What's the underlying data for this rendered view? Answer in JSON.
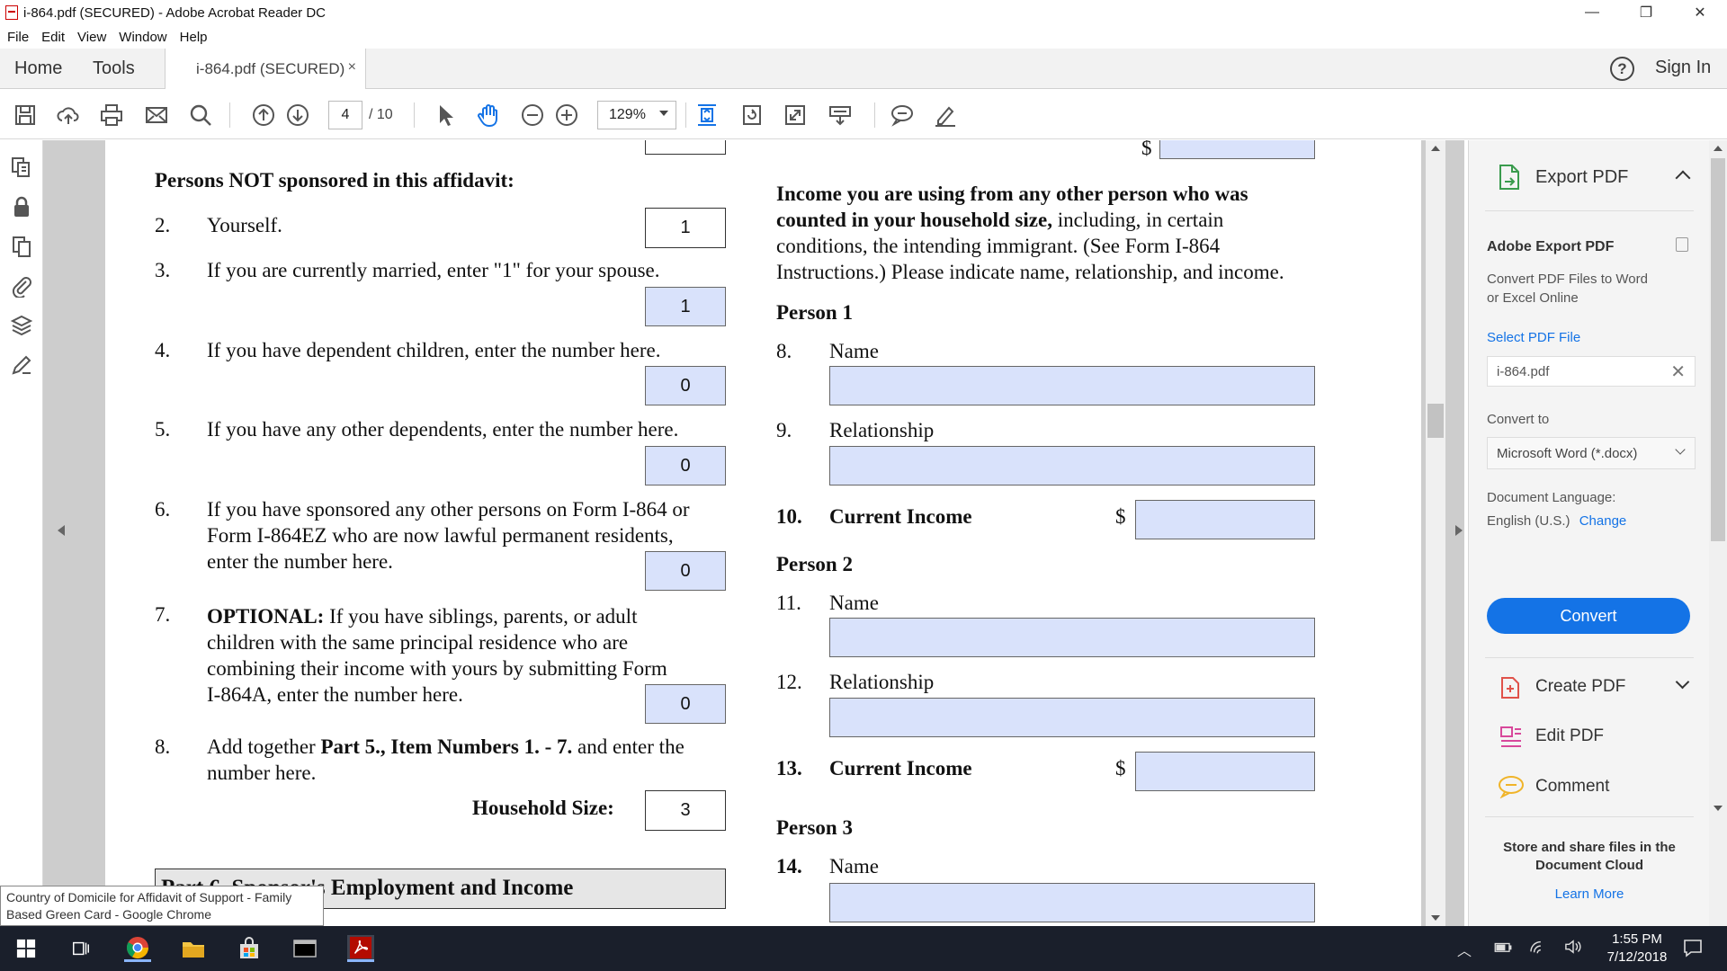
{
  "window": {
    "title": "i-864.pdf (SECURED) - Adobe Acrobat Reader DC",
    "minimize_glyph": "—",
    "maximize_glyph": "❐",
    "close_glyph": "✕"
  },
  "menu": [
    "File",
    "Edit",
    "View",
    "Window",
    "Help"
  ],
  "tabs": {
    "home": "Home",
    "tools": "Tools",
    "doc": "i-864.pdf (SECURED)",
    "close_glyph": "×",
    "help_glyph": "?",
    "sign_in": "Sign In"
  },
  "toolbar": {
    "page_current": "4",
    "page_total": "/ 10",
    "zoom": "129%"
  },
  "document": {
    "top_dollar": "$",
    "left": {
      "heading": "Persons NOT sponsored in this affidavit:",
      "items": [
        {
          "num": "2.",
          "text": "Yourself.",
          "value": "1"
        },
        {
          "num": "3.",
          "text": "If you are currently married, enter \"1\" for your spouse.",
          "value": "1"
        },
        {
          "num": "4.",
          "text": "If you have dependent children, enter the number here.",
          "value": "0"
        },
        {
          "num": "5.",
          "text": "If you have any other dependents, enter the number here.",
          "value": "0"
        },
        {
          "num": "6.",
          "lines": [
            "If you have sponsored any other persons on Form I-864 or",
            "Form I-864EZ who are now lawful permanent residents,",
            "enter the number here."
          ],
          "value": "0"
        },
        {
          "num": "7.",
          "optional_label": "OPTIONAL:",
          "lines": [
            "If you have siblings, parents, or adult",
            "children with the same principal residence who are",
            "combining their income with yours by submitting Form",
            "I-864A, enter the number here."
          ],
          "value": "0"
        },
        {
          "num": "8.",
          "line1_pre": "Add together ",
          "line1_bold": "Part 5., Item Numbers 1. - 7.",
          "line1_post": " and enter the",
          "line2": "number here."
        }
      ],
      "household_label": "Household Size:",
      "household_value": "3",
      "part6_title": "Part 6.  Sponsor's Employment and Income"
    },
    "right": {
      "intro_bold1": "Income you are using from any other person who was",
      "intro_bold2": "counted in your household size,",
      "intro_rest2": " including, in certain",
      "intro_line3": "conditions, the intending immigrant.  (See Form I-864",
      "intro_line4": "Instructions.)  Please indicate name, relationship, and income.",
      "person1": "Person 1",
      "person2": "Person 2",
      "person3": "Person 3",
      "f8": {
        "num": "8.",
        "label": "Name"
      },
      "f9": {
        "num": "9.",
        "label": "Relationship"
      },
      "f10": {
        "num": "10.",
        "label": "Current Income"
      },
      "f11": {
        "num": "11.",
        "label": "Name"
      },
      "f12": {
        "num": "12.",
        "label": "Relationship"
      },
      "f13": {
        "num": "13.",
        "label": "Current Income"
      },
      "f14": {
        "num": "14.",
        "label": "Name"
      },
      "dollar": "$"
    }
  },
  "right_panel": {
    "export_pdf": "Export PDF",
    "adobe_export_pdf": "Adobe Export PDF",
    "desc_line1": "Convert PDF Files to Word",
    "desc_line2": "or Excel Online",
    "select_file": "Select PDF File",
    "file_name": "i-864.pdf",
    "convert_to_label": "Convert to",
    "convert_to_value": "Microsoft Word (*.docx)",
    "doc_lang_label": "Document Language:",
    "doc_lang_value": "English (U.S.)",
    "change": "Change",
    "convert_btn": "Convert",
    "create_pdf": "Create PDF",
    "edit_pdf": "Edit PDF",
    "comment": "Comment",
    "cloud_line1": "Store and share files in the",
    "cloud_line2": "Document Cloud",
    "learn_more": "Learn More"
  },
  "tooltip": {
    "line1": "Country of Domicile for Affidavit of Support - Family",
    "line2": "Based Green Card - Google Chrome"
  },
  "taskbar": {
    "time": "1:55 PM",
    "date": "7/12/2018"
  },
  "colors": {
    "field_fill": "#d9e2fb",
    "convert_button": "#1473e6",
    "link": "#1473e6",
    "taskbar": "#1a1f2b"
  }
}
